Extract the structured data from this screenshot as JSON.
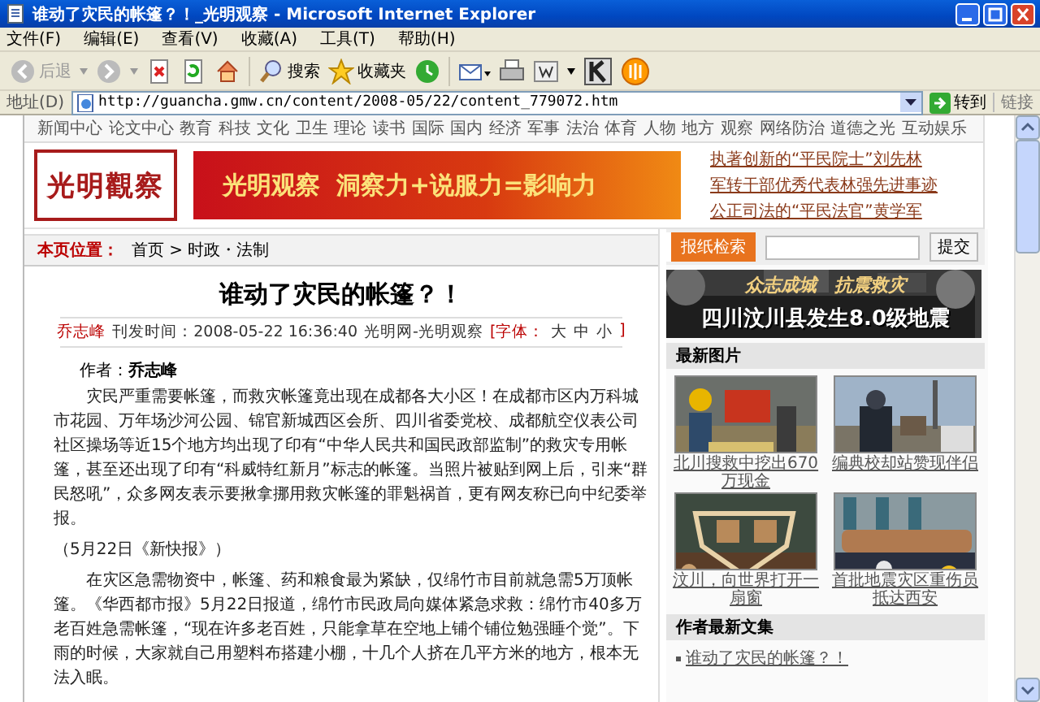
{
  "window": {
    "title": "谁动了灾民的帐篷？！_光明观察 - Microsoft Internet Explorer"
  },
  "menu": [
    "文件(F)",
    "编辑(E)",
    "查看(V)",
    "收藏(A)",
    "工具(T)",
    "帮助(H)"
  ],
  "toolbar": {
    "back": "后退",
    "search": "搜索",
    "favorites": "收藏夹"
  },
  "address": {
    "label": "地址(D)",
    "url": "http://guancha.gmw.cn/content/2008-05/22/content_779072.htm",
    "go": "转到",
    "links": "链接"
  },
  "nav": [
    "新闻中心",
    "论文中心",
    "教育",
    "科技",
    "文化",
    "卫生",
    "理论",
    "读书",
    "国际",
    "国内",
    "经济",
    "军事",
    "法治",
    "体育",
    "人物",
    "地方",
    "观察",
    "网络防治",
    "道德之光",
    "互动娱乐"
  ],
  "header": {
    "logo": "光明觀察",
    "brand": "光明观察",
    "slogan": "洞察力+说服力=影响力",
    "links": [
      "执著创新的“平民院士”刘先林",
      "军转干部优秀代表林强先进事迹",
      "公正司法的“平民法官”黄学军"
    ]
  },
  "breadcrumb": {
    "label": "本页位置：",
    "path": "首页 > 时政・法制"
  },
  "search": {
    "label": "报纸检索",
    "button": "提交"
  },
  "article": {
    "title": "谁动了灾民的帐篷？！",
    "author": "乔志峰",
    "time": "刊发时间：2008-05-22 16:36:40",
    "source": "光明网-光明观察",
    "font_open": "[字体：",
    "sizes": [
      "大",
      "中",
      "小"
    ],
    "font_close": "]",
    "byline": "作者：**乔志峰**",
    "paragraphs": [
      {
        "kind": "text",
        "text": "灾民严重需要帐篷，而救灾帐篷竟出现在成都各大小区！在成都市区内万科城市花园、万年场沙河公园、锦官新城西区会所、四川省委党校、成都航空仪表公司社区操场等近15个地方均出现了印有“中华人民共和国民政部监制”的救灾专用帐篷，甚至还出现了印有“科威特红新月”标志的帐篷。当照片被贴到网上后，引来“群民怒吼”，众多网友表示要揪拿挪用救灾帐篷的罪魁祸首，更有网友称已向中纪委举报。"
      },
      {
        "kind": "source",
        "text": "（5月22日《新快报》）"
      },
      {
        "kind": "text",
        "text": "在灾区急需物资中，帐篷、药和粮食最为紧缺，仅绵竹市目前就急需5万顶帐篷。《华西都市报》5月22日报道，绵竹市民政局向媒体紧急求救：绵竹市40多万老百姓急需帐篷，“现在许多老百姓，只能拿草在空地上铺个铺位勉强睡个觉”。下雨的时候，大家就自己用塑料布搭建小棚，十几个人挤在几平方米的地方，根本无法入眠。"
      }
    ]
  },
  "quake": {
    "slogan": "众志成城　抗震救灾",
    "headline": "四川汶川县发生8.0级地震"
  },
  "photos": {
    "heading": "最新图片",
    "items": [
      {
        "caption": "北川搜救中挖出670万现金"
      },
      {
        "caption": "编典校却站赞现伴侣"
      },
      {
        "caption": "汶川，向世界打开一扇窗"
      },
      {
        "caption": "首批地震灾区重伤员抵达西安"
      }
    ]
  },
  "author_articles": {
    "heading": "作者最新文集",
    "items": [
      "谁动了灾民的帐篷？！"
    ]
  }
}
